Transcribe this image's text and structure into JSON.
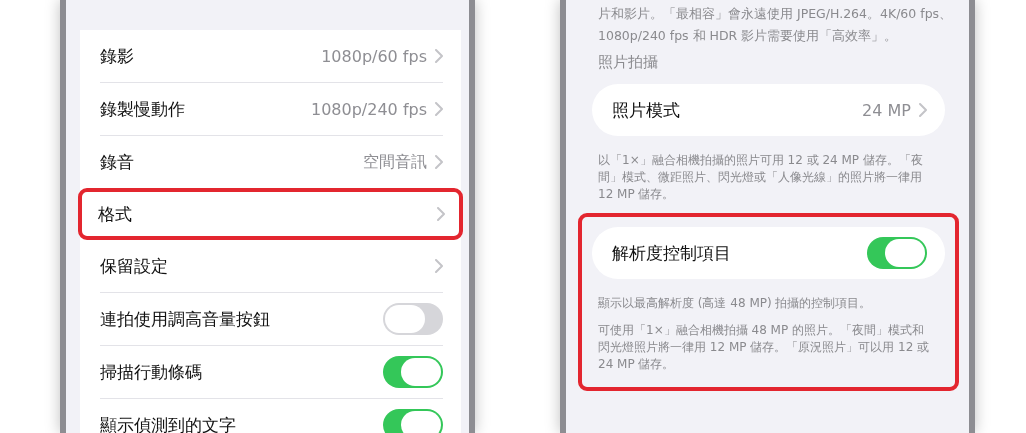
{
  "left_screen": {
    "rows": [
      {
        "kind": "link",
        "label": "錄影",
        "value": "1080p/60 fps",
        "highlighted": false
      },
      {
        "kind": "link",
        "label": "錄製慢動作",
        "value": "1080p/240 fps",
        "highlighted": false
      },
      {
        "kind": "link",
        "label": "錄音",
        "value": "空間音訊",
        "highlighted": false
      },
      {
        "kind": "link",
        "label": "格式",
        "highlighted": true
      },
      {
        "kind": "link",
        "label": "保留設定",
        "highlighted": false
      },
      {
        "kind": "toggle",
        "label": "連拍使用調高音量按鈕",
        "on": false,
        "highlighted": false
      },
      {
        "kind": "toggle",
        "label": "掃描行動條碼",
        "on": true,
        "highlighted": false
      },
      {
        "kind": "toggle",
        "label": "顯示偵測到的文字",
        "on": true,
        "highlighted": false
      }
    ]
  },
  "right_screen": {
    "intro_lines": [
      "片和影片。「最相容」會永遠使用 JPEG/H.264。4K/60 fps、",
      "1080p/240 fps 和 HDR 影片需要使用「高效率」。"
    ],
    "section_header": "照片拍攝",
    "groups": [
      {
        "highlighted": false,
        "row": {
          "kind": "link",
          "label": "照片模式",
          "value": "24 MP"
        },
        "footers": [
          [
            "以「1×」融合相機拍攝的照片可用 12 或 24 MP 儲存。「夜",
            "間」模式、微距照片、閃光燈或「人像光線」的照片將一律用",
            "12 MP 儲存。"
          ]
        ]
      },
      {
        "highlighted": true,
        "row": {
          "kind": "toggle",
          "label": "解析度控制項目",
          "on": true
        },
        "footers": [
          [
            "顯示以最高解析度 (高達 48 MP) 拍攝的控制項目。"
          ],
          [
            "可使用「1×」融合相機拍攝 48 MP 的照片。「夜間」模式和",
            "閃光燈照片將一律用 12 MP 儲存。「原況照片」可以用 12 或",
            "24 MP 儲存。"
          ]
        ]
      }
    ]
  }
}
